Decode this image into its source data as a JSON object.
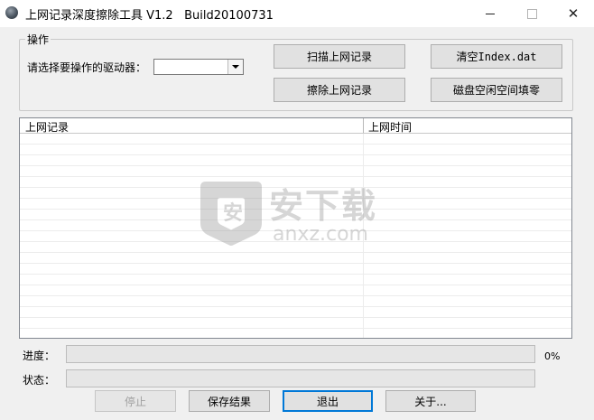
{
  "window": {
    "title": "上网记录深度擦除工具 V1.2   Build20100731",
    "minimize_glyph": "—",
    "maximize_glyph": "☐",
    "close_glyph": "✕"
  },
  "operation_group": {
    "legend": "操作",
    "drive_label": "请选择要操作的驱动器：",
    "drive_value": "",
    "buttons": {
      "scan": "扫描上网记录",
      "erase": "擦除上网记录",
      "clear_index": "清空Index.dat",
      "fill_zero": "磁盘空闲空间填零"
    }
  },
  "records_table": {
    "columns": [
      "上网记录",
      "上网时间"
    ],
    "rows": []
  },
  "watermark": {
    "brand_cn": "安下载",
    "brand_url": "anxz.com"
  },
  "progress": {
    "label": "进度：",
    "value_percent": 0,
    "value_text": "0%"
  },
  "status": {
    "label": "状态：",
    "text": ""
  },
  "footer_buttons": {
    "stop": "停止",
    "save": "保存结果",
    "exit": "退出",
    "about": "关于..."
  }
}
